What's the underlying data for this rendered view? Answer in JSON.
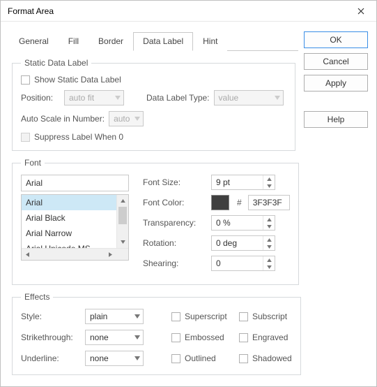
{
  "title": "Format Area",
  "buttons": {
    "ok": "OK",
    "cancel": "Cancel",
    "apply": "Apply",
    "help": "Help"
  },
  "tabs": [
    "General",
    "Fill",
    "Border",
    "Data Label",
    "Hint"
  ],
  "active_tab": "Data Label",
  "static_data_label": {
    "legend": "Static Data Label",
    "show_label": "Show Static Data Label",
    "position_label": "Position:",
    "position_value": "auto fit",
    "type_label": "Data Label Type:",
    "type_value": "value",
    "autoscale_label": "Auto Scale in Number:",
    "autoscale_value": "auto",
    "suppress_label": "Suppress Label When 0"
  },
  "font": {
    "legend": "Font",
    "name_value": "Arial",
    "list": [
      "Arial",
      "Arial Black",
      "Arial Narrow",
      "Arial Unicode MS"
    ],
    "size_label": "Font Size:",
    "size_value": "9 pt",
    "color_label": "Font Color:",
    "color_hex": "3F3F3F",
    "transparency_label": "Transparency:",
    "transparency_value": "0 %",
    "rotation_label": "Rotation:",
    "rotation_value": "0 deg",
    "shearing_label": "Shearing:",
    "shearing_value": "0"
  },
  "effects": {
    "legend": "Effects",
    "style_label": "Style:",
    "style_value": "plain",
    "strike_label": "Strikethrough:",
    "strike_value": "none",
    "underline_label": "Underline:",
    "underline_value": "none",
    "superscript": "Superscript",
    "subscript": "Subscript",
    "embossed": "Embossed",
    "engraved": "Engraved",
    "outlined": "Outlined",
    "shadowed": "Shadowed"
  }
}
